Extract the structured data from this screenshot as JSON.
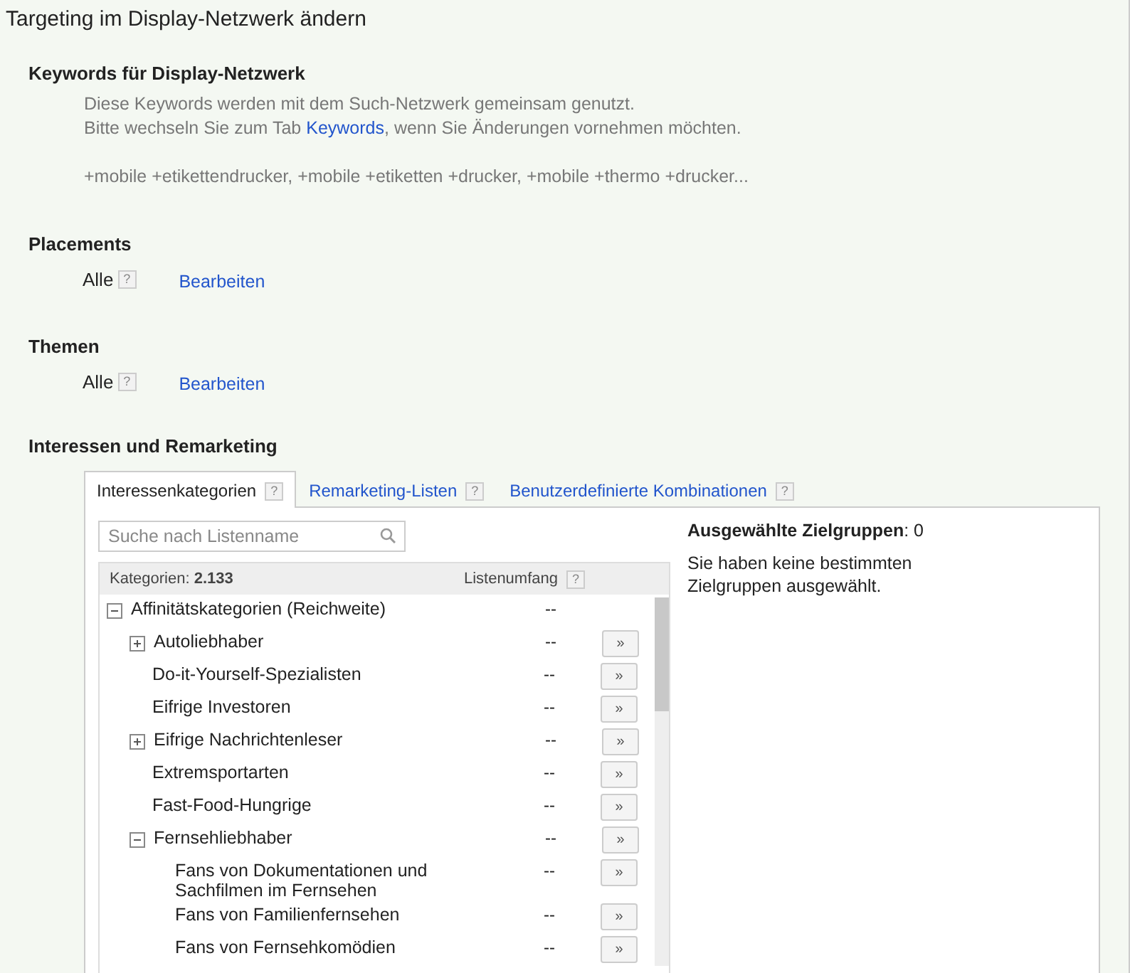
{
  "title": "Targeting im Display-Netzwerk ändern",
  "keywords": {
    "heading": "Keywords für Display-Netzwerk",
    "info": "Diese Keywords werden mit dem Such-Netzwerk gemeinsam genutzt.",
    "hint_before": "Bitte wechseln Sie zum Tab ",
    "hint_link": "Keywords",
    "hint_after": ", wenn Sie Änderungen vornehmen möchten.",
    "list": "+mobile +etikettendrucker, +mobile +etiketten +drucker, +mobile +thermo +drucker..."
  },
  "placements": {
    "heading": "Placements",
    "value": "Alle",
    "help": "?",
    "edit": "Bearbeiten"
  },
  "themes": {
    "heading": "Themen",
    "value": "Alle",
    "help": "?",
    "edit": "Bearbeiten"
  },
  "interests": {
    "heading": "Interessen und Remarketing",
    "tabs": [
      {
        "label": "Interessenkategorien",
        "help": "?",
        "selected": true
      },
      {
        "label": "Remarketing-Listen",
        "help": "?",
        "selected": false
      },
      {
        "label": "Benutzerdefinierte Kombinationen",
        "help": "?",
        "selected": false
      }
    ],
    "search": {
      "placeholder": "Suche nach Listenname"
    },
    "table": {
      "count_label": "Kategorien: ",
      "count": "2.133",
      "reach_label": "Listenumfang",
      "reach_help": "?"
    },
    "tree": [
      {
        "label": "Affinitätskategorien (Reichweite)",
        "reach": "--",
        "add": false,
        "expanded": true,
        "children": [
          {
            "label": "Autoliebhaber",
            "reach": "--",
            "add": true,
            "expanded": false
          },
          {
            "label": "Do-it-Yourself-Spezialisten",
            "reach": "--",
            "add": true
          },
          {
            "label": "Eifrige Investoren",
            "reach": "--",
            "add": true
          },
          {
            "label": "Eifrige Nachrichtenleser",
            "reach": "--",
            "add": true,
            "expanded": false
          },
          {
            "label": "Extremsportarten",
            "reach": "--",
            "add": true
          },
          {
            "label": "Fast-Food-Hungrige",
            "reach": "--",
            "add": true
          },
          {
            "label": "Fernsehliebhaber",
            "reach": "--",
            "add": true,
            "expanded": true,
            "children": [
              {
                "label": "Fans von Dokumentationen und Sachfilmen im Fernsehen",
                "reach": "--",
                "add": true
              },
              {
                "label": "Fans von Familienfernsehen",
                "reach": "--",
                "add": true
              },
              {
                "label": "Fans von Fernsehkomödien",
                "reach": "--",
                "add": true
              }
            ]
          }
        ]
      }
    ],
    "add_symbol": "»",
    "selected": {
      "label": "Ausgewählte Zielgruppen",
      "count": ": 0",
      "message": "Sie haben keine bestimmten Zielgruppen ausgewählt."
    }
  }
}
